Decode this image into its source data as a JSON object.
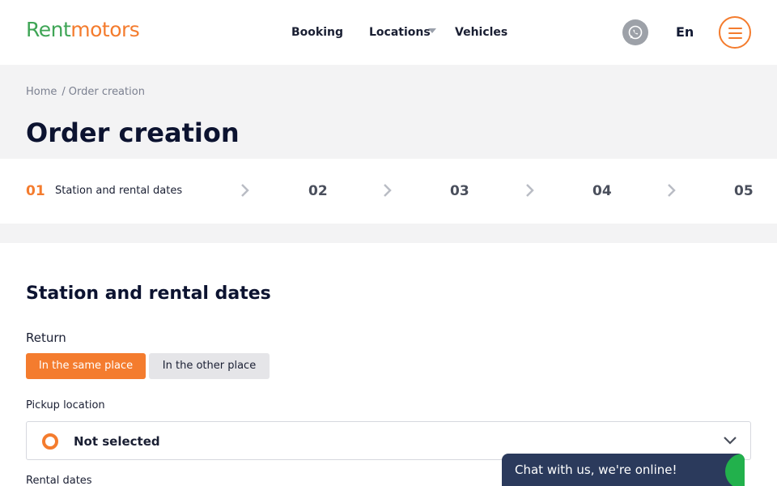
{
  "header": {
    "logo_part1": "Rent",
    "logo_part2": "motors",
    "nav": [
      "Booking",
      "Locations",
      "Vehicles"
    ],
    "language": "En",
    "icons": [
      "whatsapp-icon",
      "chevron-down-icon",
      "menu-icon"
    ]
  },
  "breadcrumb": {
    "home": "Home",
    "separator": "/",
    "current": "Order creation"
  },
  "page_title": "Order creation",
  "stepper": {
    "steps": [
      {
        "number": "01",
        "label": "Station and rental dates",
        "active": true
      },
      {
        "number": "02",
        "label": ""
      },
      {
        "number": "03",
        "label": ""
      },
      {
        "number": "04",
        "label": ""
      },
      {
        "number": "05",
        "label": ""
      }
    ]
  },
  "form": {
    "section_title": "Station and rental dates",
    "return_label": "Return",
    "return_options": [
      "In the same place",
      "In the other place"
    ],
    "pickup_label": "Pickup location",
    "pickup_value": "Not selected",
    "dates_label": "Rental dates"
  },
  "chat": {
    "text": "Chat with us, we're online!"
  },
  "colors": {
    "accent": "#f47c2e",
    "logo_green": "#3fa556",
    "chat_bg": "#2b3a5c",
    "online": "#22b14c"
  }
}
